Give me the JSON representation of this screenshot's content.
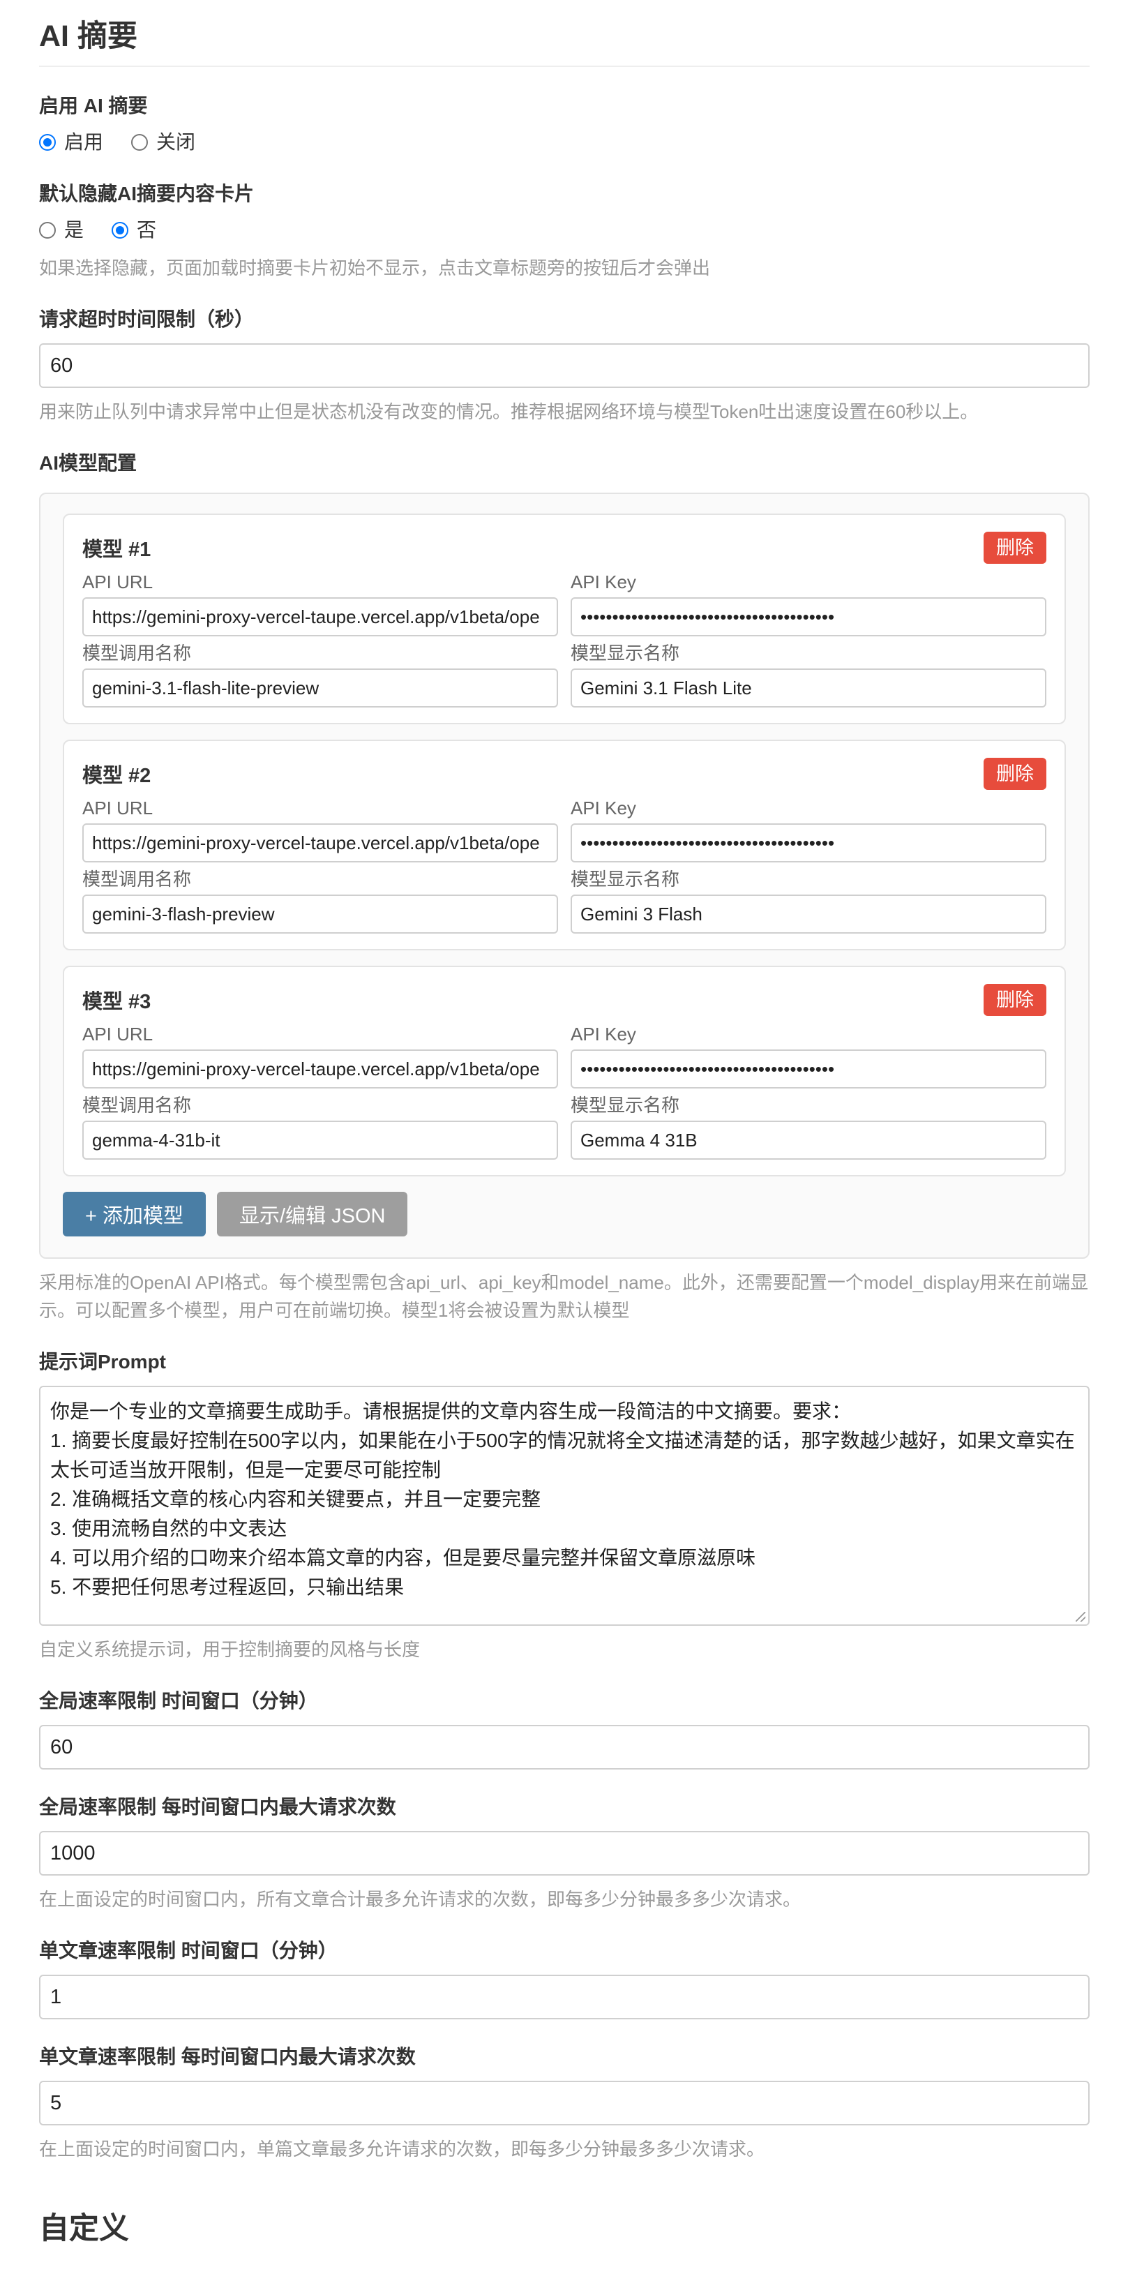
{
  "ai_summary": {
    "title": "AI 摘要",
    "enable": {
      "label": "启用 AI 摘要",
      "options": [
        "启用",
        "关闭"
      ],
      "selected": "启用"
    },
    "hide_card": {
      "label": "默认隐藏AI摘要内容卡片",
      "options": [
        "是",
        "否"
      ],
      "selected": "否",
      "hint": "如果选择隐藏，页面加载时摘要卡片初始不显示，点击文章标题旁的按钮后才会弹出"
    },
    "timeout": {
      "label": "请求超时时间限制（秒）",
      "value": "60",
      "hint": "用来防止队列中请求异常中止但是状态机没有改变的情况。推荐根据网络环境与模型Token吐出速度设置在60秒以上。"
    },
    "models": {
      "label": "AI模型配置",
      "field_labels": {
        "api_url": "API URL",
        "api_key": "API Key",
        "model_name": "模型调用名称",
        "display_name": "模型显示名称"
      },
      "delete_label": "删除",
      "items": [
        {
          "title": "模型 #1",
          "api_url": "https://gemini-proxy-vercel-taupe.vercel.app/v1beta/ope",
          "api_key": "••••••••••••••••••••••••••••••••••••••••",
          "model_name": "gemini-3.1-flash-lite-preview",
          "display_name": "Gemini 3.1 Flash Lite"
        },
        {
          "title": "模型 #2",
          "api_url": "https://gemini-proxy-vercel-taupe.vercel.app/v1beta/ope",
          "api_key": "••••••••••••••••••••••••••••••••••••••••",
          "model_name": "gemini-3-flash-preview",
          "display_name": "Gemini 3 Flash"
        },
        {
          "title": "模型 #3",
          "api_url": "https://gemini-proxy-vercel-taupe.vercel.app/v1beta/ope",
          "api_key": "••••••••••••••••••••••••••••••••••••••••",
          "model_name": "gemma-4-31b-it",
          "display_name": "Gemma 4 31B"
        }
      ],
      "add_label": "+ 添加模型",
      "json_label": "显示/编辑 JSON",
      "hint": "采用标准的OpenAI API格式。每个模型需包含api_url、api_key和model_name。此外，还需要配置一个model_display用来在前端显示。可以配置多个模型，用户可在前端切换。模型1将会被设置为默认模型"
    },
    "prompt": {
      "label": "提示词Prompt",
      "value": "你是一个专业的文章摘要生成助手。请根据提供的文章内容生成一段简洁的中文摘要。要求：\n1. 摘要长度最好控制在500字以内，如果能在小于500字的情况就将全文描述清楚的话，那字数越少越好，如果文章实在太长可适当放开限制，但是一定要尽可能控制\n2. 准确概括文章的核心内容和关键要点，并且一定要完整\n3. 使用流畅自然的中文表达\n4. 可以用介绍的口吻来介绍本篇文章的内容，但是要尽量完整并保留文章原滋原味\n5. 不要把任何思考过程返回，只输出结果",
      "hint": "自定义系统提示词，用于控制摘要的风格与长度"
    },
    "global_window": {
      "label": "全局速率限制 时间窗口（分钟）",
      "value": "60"
    },
    "global_max": {
      "label": "全局速率限制 每时间窗口内最大请求次数",
      "value": "1000",
      "hint": "在上面设定的时间窗口内，所有文章合计最多允许请求的次数，即每多少分钟最多多少次请求。"
    },
    "article_window": {
      "label": "单文章速率限制 时间窗口（分钟）",
      "value": "1"
    },
    "article_max": {
      "label": "单文章速率限制 每时间窗口内最大请求次数",
      "value": "5",
      "hint": "在上面设定的时间窗口内，单篇文章最多允许请求的次数，即每多少分钟最多多少次请求。"
    }
  },
  "custom": {
    "title": "自定义"
  },
  "colors": {
    "radio_checked": "#0075ff",
    "delete_button": "#e74c3c",
    "add_button": "#4a7ea5",
    "json_button": "#9e9e9e",
    "hint_text": "#999999"
  }
}
